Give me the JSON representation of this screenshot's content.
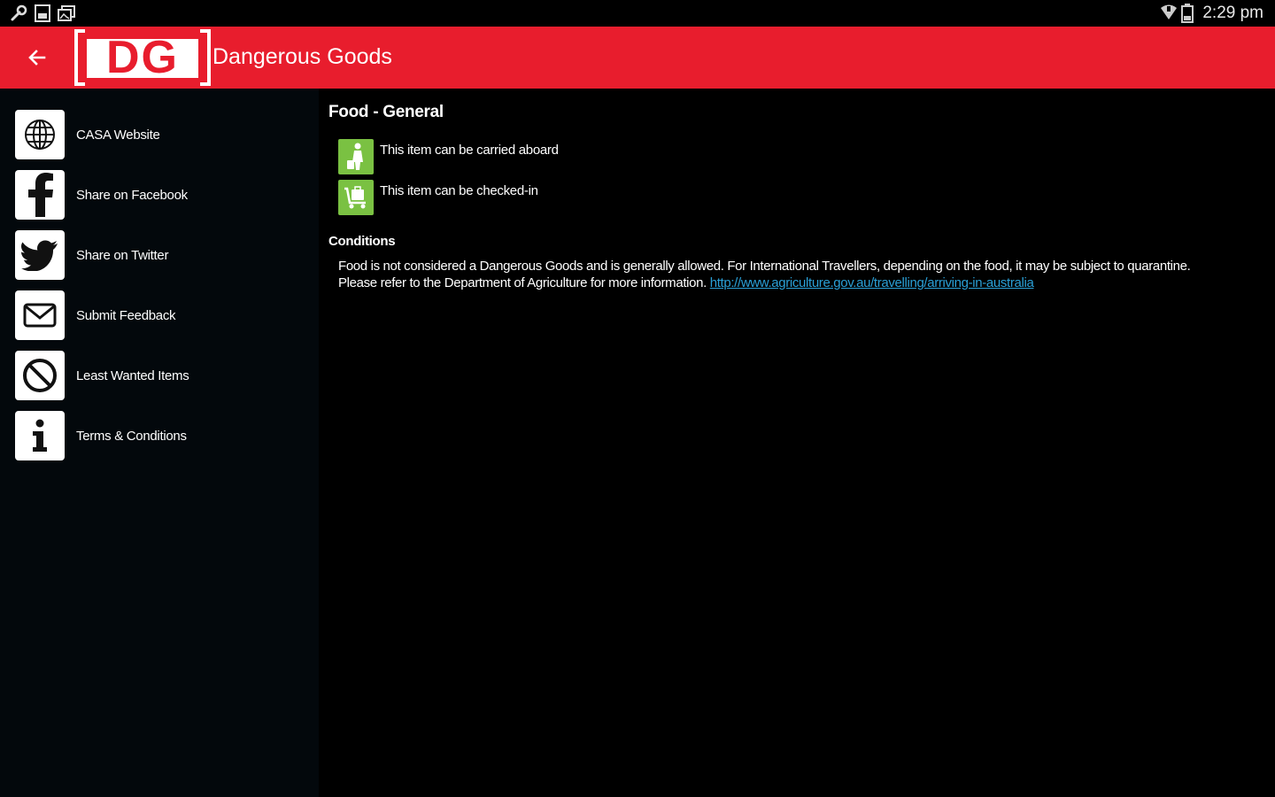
{
  "status_bar": {
    "time": "2:29 pm",
    "left_icons": [
      "wrench-icon",
      "sd-card-icon",
      "gallery-icon"
    ],
    "right_icons": [
      "wifi-icon",
      "battery-icon"
    ]
  },
  "app_bar": {
    "logo_text": "DG",
    "title": "Dangerous Goods",
    "background": "#e81d2d"
  },
  "sidebar": {
    "items": [
      {
        "label": "CASA Website",
        "icon": "globe-icon"
      },
      {
        "label": "Share on Facebook",
        "icon": "facebook-icon"
      },
      {
        "label": "Share on Twitter",
        "icon": "twitter-icon"
      },
      {
        "label": "Submit Feedback",
        "icon": "envelope-icon"
      },
      {
        "label": "Least Wanted Items",
        "icon": "prohibited-icon"
      },
      {
        "label": "Terms & Conditions",
        "icon": "info-icon"
      }
    ]
  },
  "item": {
    "title": "Food - General",
    "permissions": [
      {
        "text": "This item can be carried aboard",
        "icon": "carry-on-passenger-icon"
      },
      {
        "text": "This item can be checked-in",
        "icon": "checked-luggage-icon"
      }
    ],
    "permission_color": "#7ac142",
    "conditions_heading": "Conditions",
    "conditions_text": "Food is not considered a Dangerous Goods and is generally allowed. For International Travellers, depending on the food, it may be subject to quarantine. Please refer to the Department of Agriculture for more information. ",
    "conditions_link": "http://www.agriculture.gov.au/travelling/arriving-in-australia",
    "link_color": "#2a9fd6"
  }
}
